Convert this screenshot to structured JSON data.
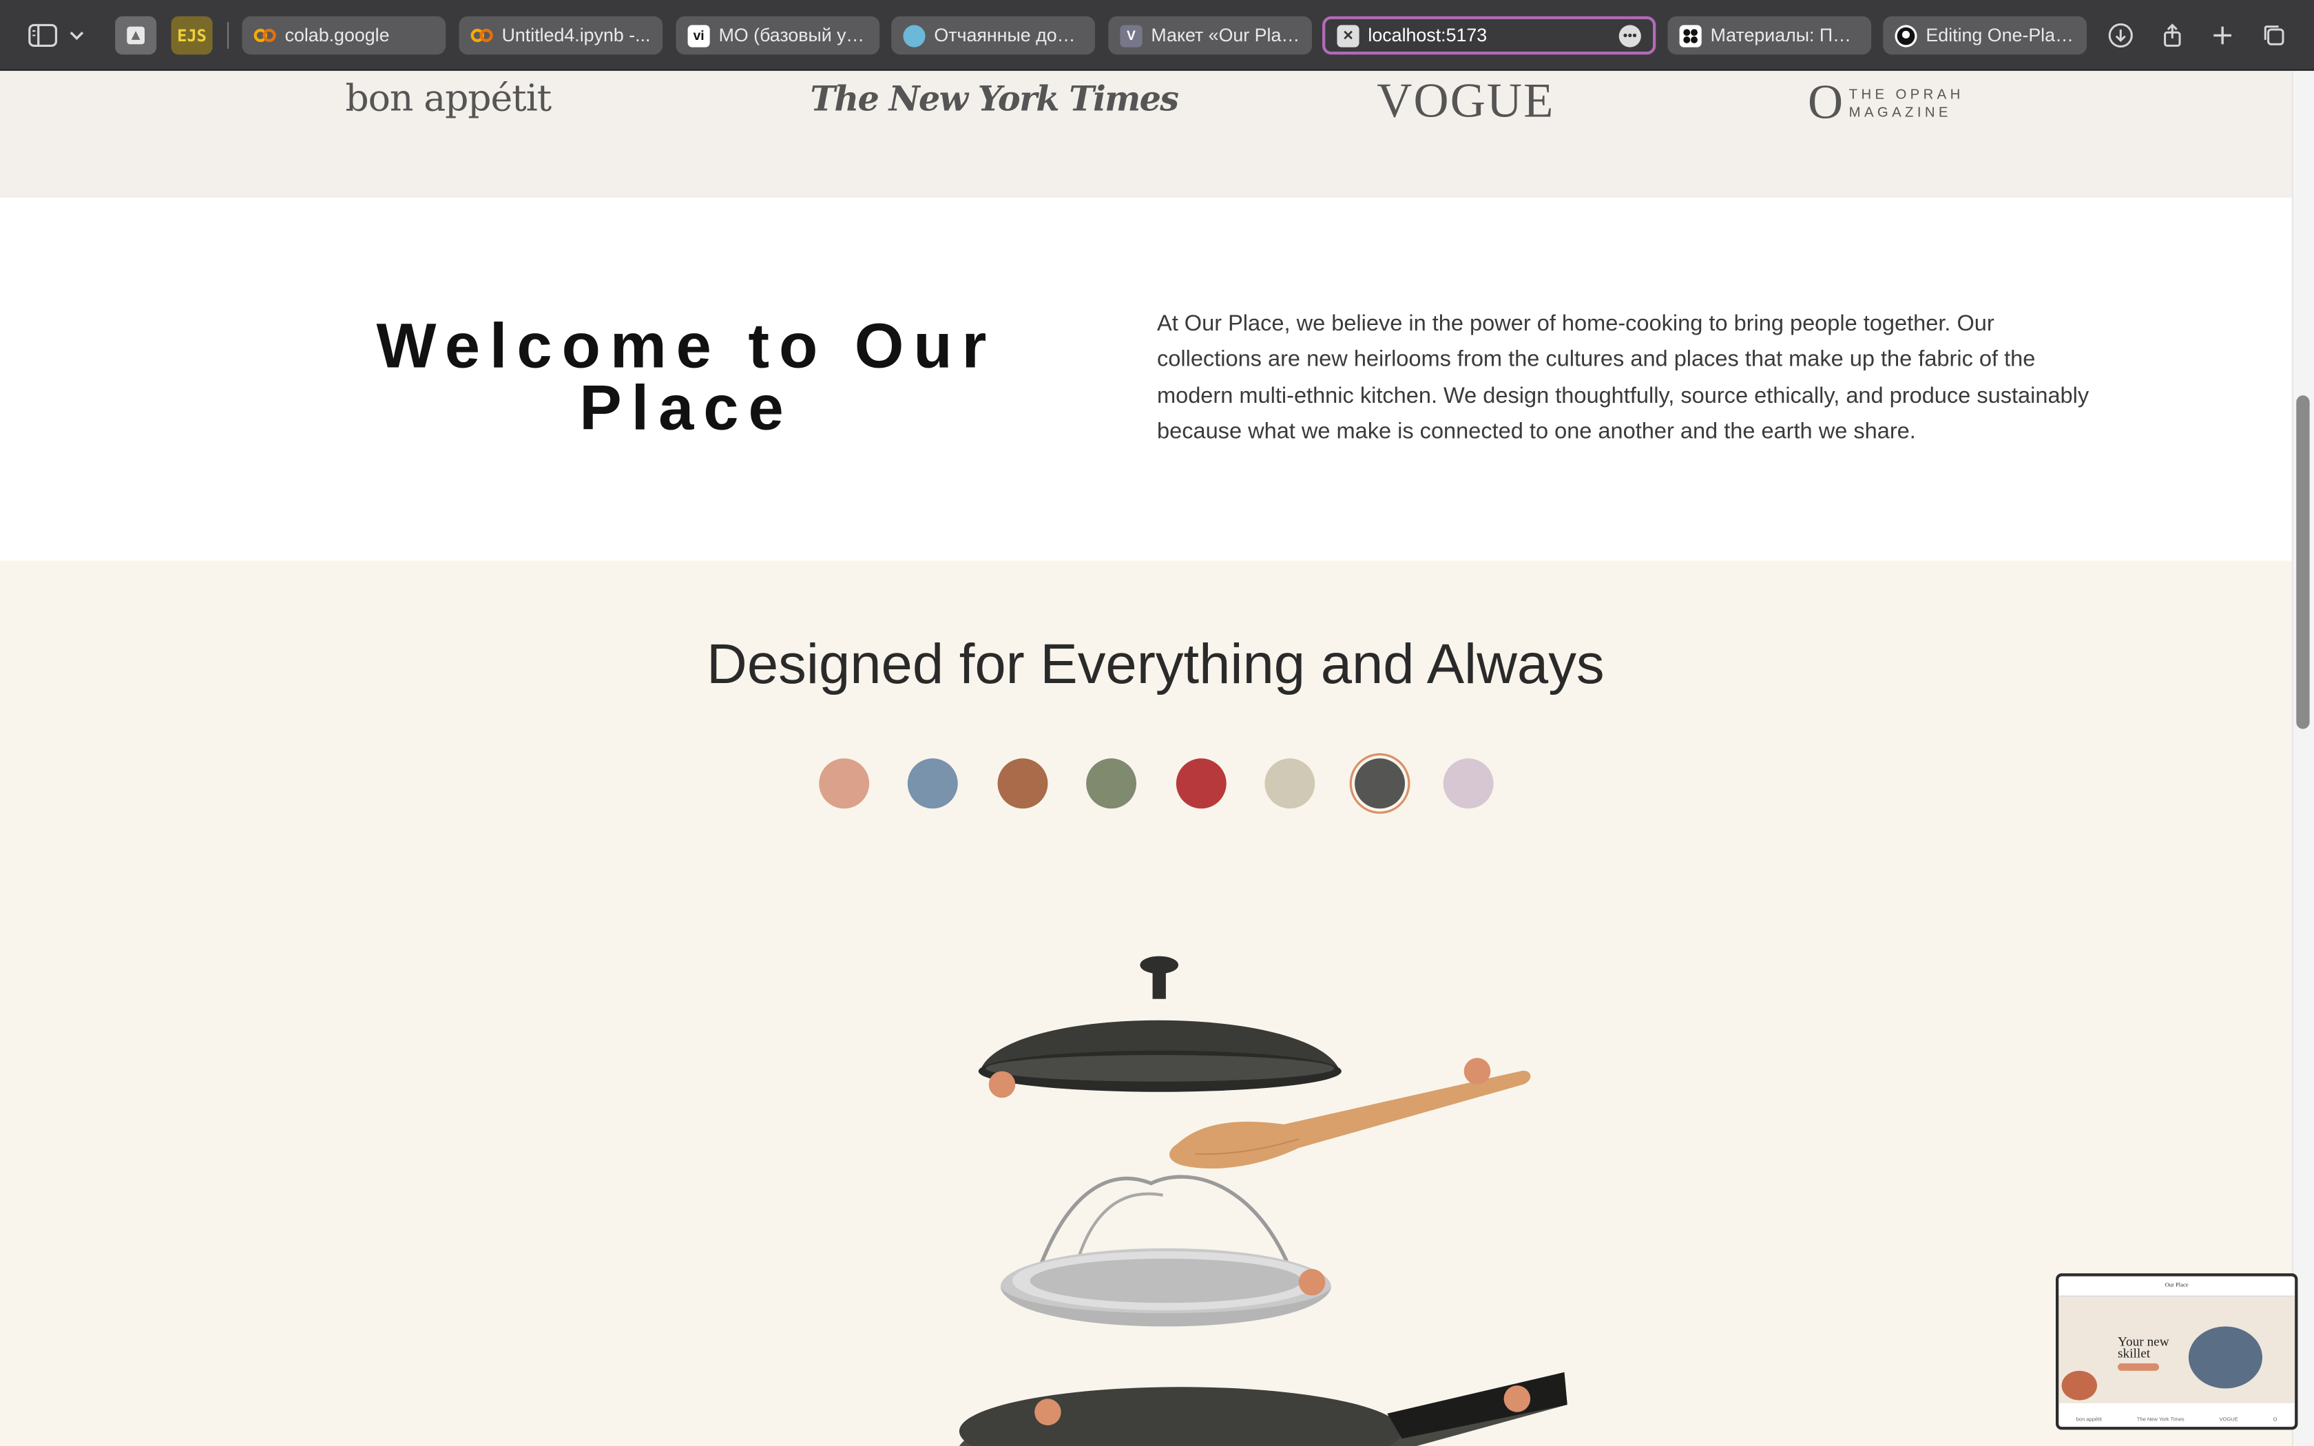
{
  "browser": {
    "tabs": [
      {
        "label": "colab.google",
        "favicon": "colab-icon"
      },
      {
        "label": "Untitled4.ipynb -...",
        "favicon": "colab-icon"
      },
      {
        "label": "МО (базовый ур...",
        "favicon": "vi-icon"
      },
      {
        "label": "Отчаянные домо...",
        "favicon": "globe-icon"
      },
      {
        "label": "Макет «Our Plac...",
        "favicon": "v-icon"
      },
      {
        "label": "localhost:5173",
        "favicon": "close-icon",
        "active": true
      },
      {
        "label": "Материалы: Пре...",
        "favicon": "figma-icon"
      },
      {
        "label": "Editing One-Plac...",
        "favicon": "github-icon"
      }
    ],
    "extension_label": "EJS",
    "v_glyph": "V"
  },
  "press": {
    "bon": "bon appétit",
    "nyt": "The New York Times",
    "vogue": "VOGUE",
    "oprah_o": "O",
    "oprah_line1": "THE OPRAH",
    "oprah_line2": "MAGAZINE"
  },
  "welcome": {
    "title": "Welcome to Our Place",
    "body": "At Our Place, we believe in the power of home-cooking to bring people together. Our collections are new heirlooms from the cultures and places that make up the fabric of the modern multi-ethnic kitchen. We design thoughtfully, source ethically, and produce sustainably because what we make is connected to one another and the earth we share."
  },
  "designed": {
    "title": "Designed for Everything and Always",
    "swatches": [
      {
        "color": "#dba18a"
      },
      {
        "color": "#7893ab"
      },
      {
        "color": "#a96b49"
      },
      {
        "color": "#7f8a6f"
      },
      {
        "color": "#b8393b"
      },
      {
        "color": "#cfc9b5"
      },
      {
        "color": "#555553",
        "selected": true
      },
      {
        "color": "#d6c7d3"
      }
    ],
    "hotspot_color": "#d9906b"
  },
  "preview": {
    "brand": "Our Place",
    "hero_line1": "Your new",
    "hero_line2": "skillet",
    "logos": [
      "bon appétit",
      "The New York Times",
      "VOGUE",
      "O"
    ]
  }
}
